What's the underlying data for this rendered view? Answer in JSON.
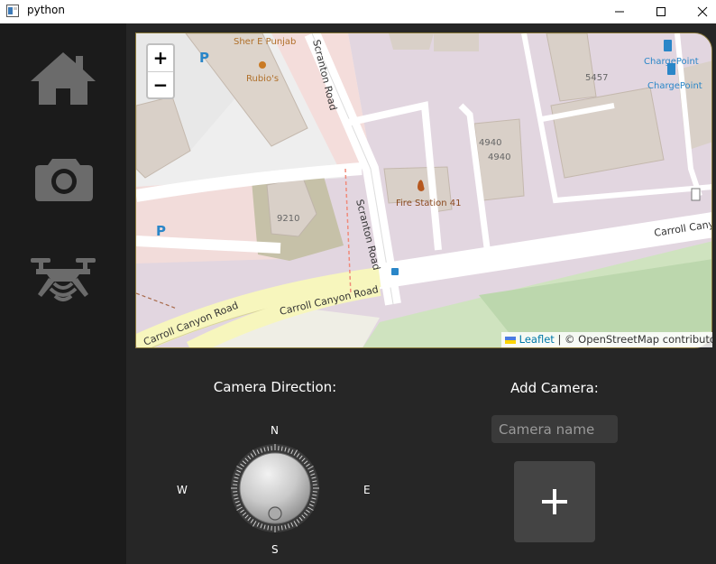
{
  "window": {
    "title": "python",
    "controls": [
      "minimize-icon",
      "maximize-icon",
      "close-icon"
    ]
  },
  "sidebar": {
    "items": [
      {
        "name": "home",
        "icon": "home-icon"
      },
      {
        "name": "camera",
        "icon": "camera-icon"
      },
      {
        "name": "drone",
        "icon": "drone-icon"
      }
    ],
    "icon_color": "#6b6b6b"
  },
  "map": {
    "zoom_in": "+",
    "zoom_out": "−",
    "labels": {
      "restaurant": "Sher E Punjab",
      "fastfood": "Rubio's",
      "parking": "P",
      "road_scranton": "Scranton Road",
      "road_carroll": "Carroll Canyon Road",
      "road_carroll_right": "Carroll Canyo",
      "fire_station": "Fire Station 41",
      "addr_9210": "9210",
      "addr_4940": "4940",
      "addr_5457": "5457",
      "chargepoint": "ChargePoint"
    },
    "attribution": {
      "leaflet": "Leaflet",
      "separator": " | © ",
      "osm": "OpenStreetMap contributors"
    }
  },
  "camera_direction": {
    "label": "Camera Direction:",
    "north": "N",
    "south": "S",
    "east": "E",
    "west": "W"
  },
  "add_camera": {
    "label": "Add Camera:",
    "input_placeholder": "Camera name",
    "input_value": "",
    "button_icon": "plus-icon"
  },
  "colors": {
    "sidebar_bg": "#1b1b1b",
    "content_bg": "#262626",
    "button_bg": "#444444",
    "input_bg": "#3a3a3a"
  }
}
